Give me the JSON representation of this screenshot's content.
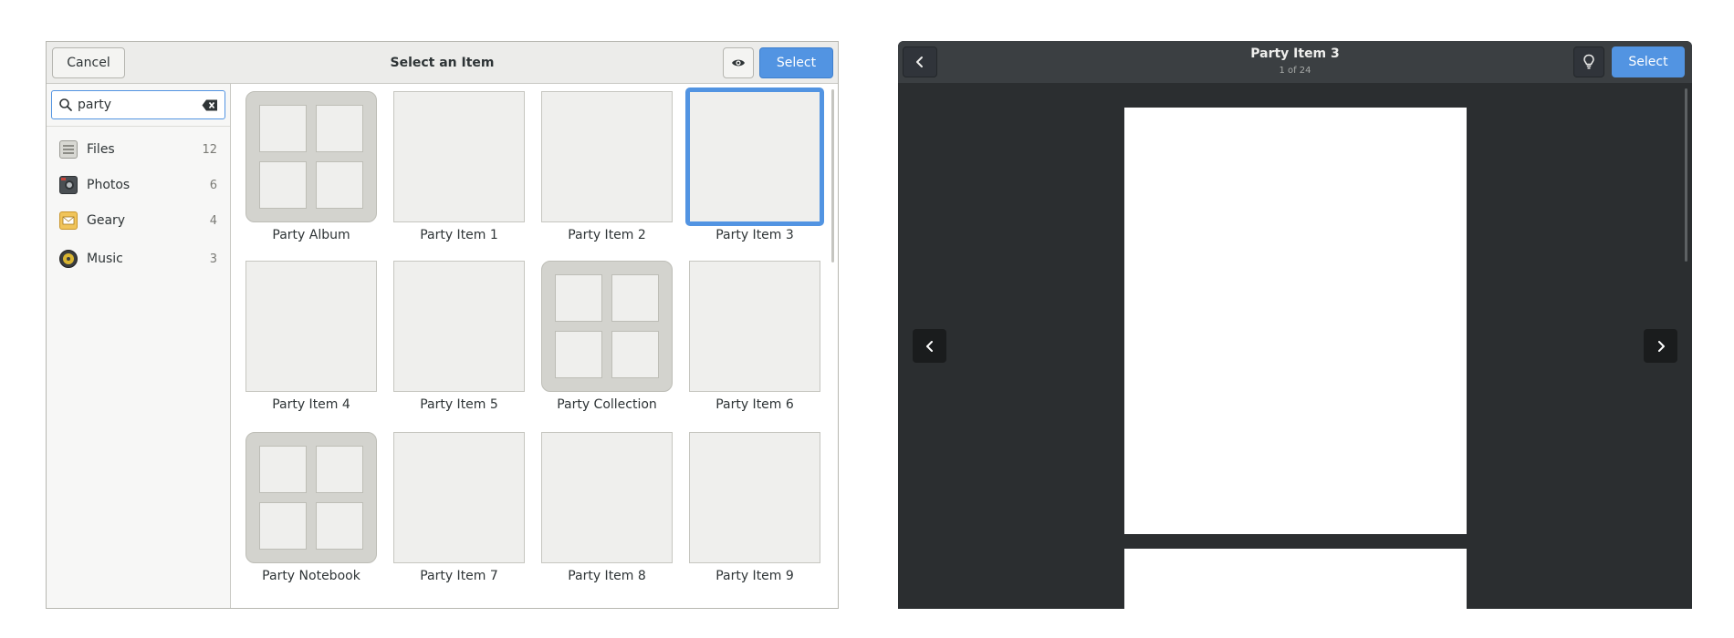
{
  "chooser": {
    "cancel_label": "Cancel",
    "title": "Select an Item",
    "select_label": "Select",
    "search": {
      "value": "party"
    },
    "sources": [
      {
        "name": "Files",
        "count": "12",
        "icon": "files-icon"
      },
      {
        "name": "Photos",
        "count": "6",
        "icon": "camera-icon"
      },
      {
        "name": "Geary",
        "count": "4",
        "icon": "mail-icon"
      },
      {
        "name": "Music",
        "count": "3",
        "icon": "speaker-icon"
      }
    ],
    "items": [
      {
        "name": "Party Album",
        "kind": "collection"
      },
      {
        "name": "Party Item 1",
        "kind": "item"
      },
      {
        "name": "Party Item 2",
        "kind": "item"
      },
      {
        "name": "Party Item 3",
        "kind": "item",
        "selected": true
      },
      {
        "name": "Party Item 4",
        "kind": "item"
      },
      {
        "name": "Party Item 5",
        "kind": "item"
      },
      {
        "name": "Party Collection",
        "kind": "collection"
      },
      {
        "name": "Party Item 6",
        "kind": "item"
      },
      {
        "name": "Party Notebook",
        "kind": "collection"
      },
      {
        "name": "Party Item 7",
        "kind": "item"
      },
      {
        "name": "Party Item 8",
        "kind": "item"
      },
      {
        "name": "Party Item 9",
        "kind": "item"
      }
    ]
  },
  "viewer": {
    "title": "Party Item 3",
    "subtitle": "1 of 24",
    "select_label": "Select"
  },
  "colors": {
    "accent": "#5294e2",
    "viewer_bg": "#2b2e30",
    "viewer_header": "#3b3f42"
  }
}
